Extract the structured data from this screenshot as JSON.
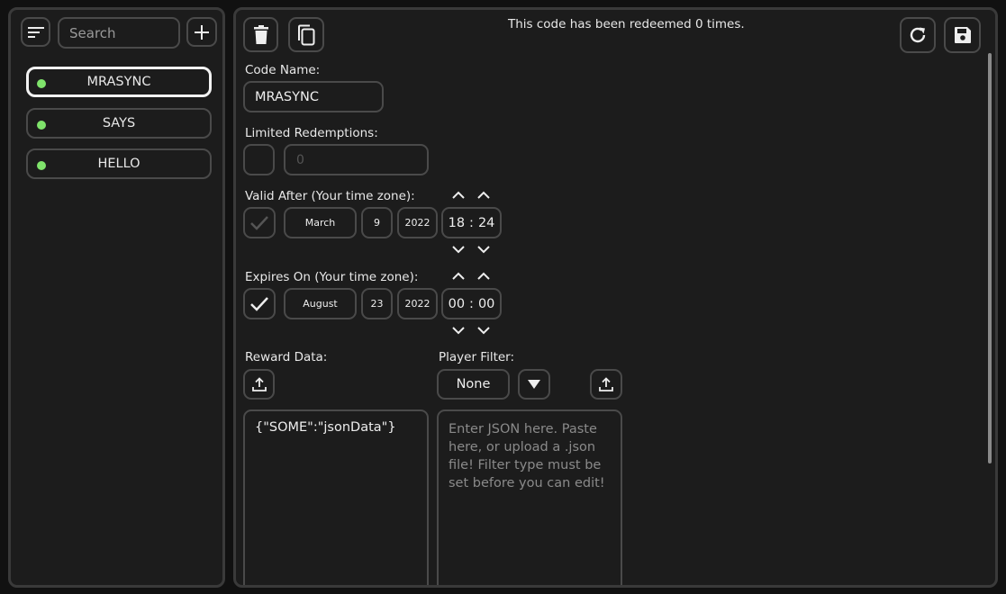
{
  "sidebar": {
    "search_placeholder": "Search",
    "codes": [
      {
        "label": "MRASYNC",
        "selected": true,
        "status_color": "#7fe36b"
      },
      {
        "label": "SAYS",
        "selected": false,
        "status_color": "#7fe36b"
      },
      {
        "label": "HELLO",
        "selected": false,
        "status_color": "#7fe36b"
      }
    ]
  },
  "editor": {
    "redeemed_text": "This code has been redeemed 0 times.",
    "code_name_label": "Code Name:",
    "code_name_value": "MRASYNC",
    "limited_label": "Limited Redemptions:",
    "limited_placeholder": "0",
    "limited_checked": false,
    "valid_after": {
      "label": "Valid After (Your time zone):",
      "checked": false,
      "month": "March",
      "day": "9",
      "year": "2022",
      "hour": "18",
      "minute": "24"
    },
    "expires_on": {
      "label": "Expires On (Your time zone):",
      "checked": true,
      "month": "August",
      "day": "23",
      "year": "2022",
      "hour": "00",
      "minute": "00"
    },
    "time_separator": ":",
    "reward_label": "Reward Data:",
    "reward_value": "{\"SOME\":\"jsonData\"}",
    "filter_label": "Player Filter:",
    "filter_value": "None",
    "filter_placeholder": "Enter JSON here.  Paste here, or upload a .json file!  Filter type must be set before you can edit!"
  },
  "colors": {
    "accent_green": "#7fe36b",
    "border": "#4a4a4a",
    "panel": "#1c1c1c"
  }
}
